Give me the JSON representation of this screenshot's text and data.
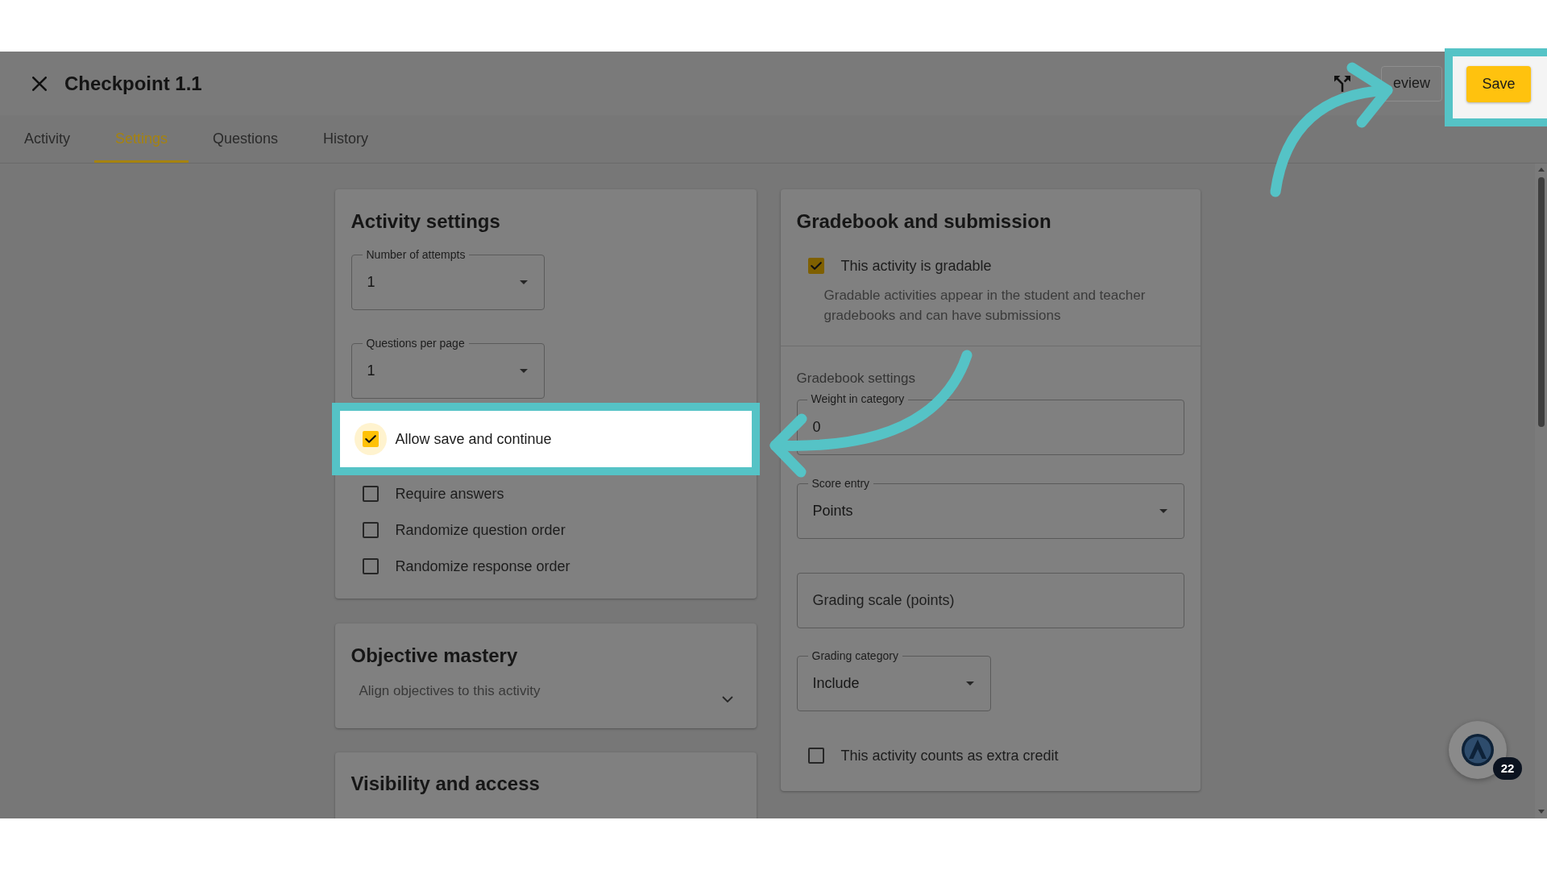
{
  "window": {
    "title": "Checkpoint 1.1"
  },
  "toolbar": {
    "preview": {
      "label": "eview"
    },
    "save": {
      "label": "Save",
      "highlighted": true
    }
  },
  "tabs": [
    {
      "label": "Activity",
      "selected": false
    },
    {
      "label": "Settings",
      "selected": true
    },
    {
      "label": "Questions",
      "selected": false
    },
    {
      "label": "History",
      "selected": false
    }
  ],
  "activity_settings": {
    "title": "Activity settings",
    "selects": [
      {
        "label": "Number of attempts",
        "value": "1"
      },
      {
        "label": "Questions per page",
        "value": "1"
      }
    ],
    "options": [
      {
        "label": "Allow save and continue",
        "checked": true,
        "highlighted": true
      },
      {
        "label": "Require answers",
        "checked": false,
        "highlighted": false
      },
      {
        "label": "Randomize question order",
        "checked": false,
        "highlighted": false
      },
      {
        "label": "Randomize response order",
        "checked": false,
        "highlighted": false
      }
    ]
  },
  "objective_mastery": {
    "title": "Objective mastery",
    "summary": "Align objectives to this activity",
    "expanded": false
  },
  "visibility_access": {
    "title": "Visibility and access"
  },
  "gradebook": {
    "title": "Gradebook and submission",
    "gradable": {
      "label": "This activity is gradable",
      "checked": true,
      "description": "Gradable activities appear in the student and teacher gradebooks and can have submissions"
    },
    "settings_heading": "Gradebook settings",
    "fields": [
      {
        "kind": "text",
        "label": "Weight in category",
        "value": "0"
      },
      {
        "kind": "select",
        "label": "Score entry",
        "value": "Points"
      },
      {
        "kind": "text",
        "placeholder": "Grading scale (points)"
      },
      {
        "kind": "select",
        "label": "Grading category",
        "value": "Include"
      }
    ],
    "extra_credit": {
      "label": "This activity counts as extra credit",
      "checked": false
    }
  },
  "chat": {
    "badge": "22"
  }
}
